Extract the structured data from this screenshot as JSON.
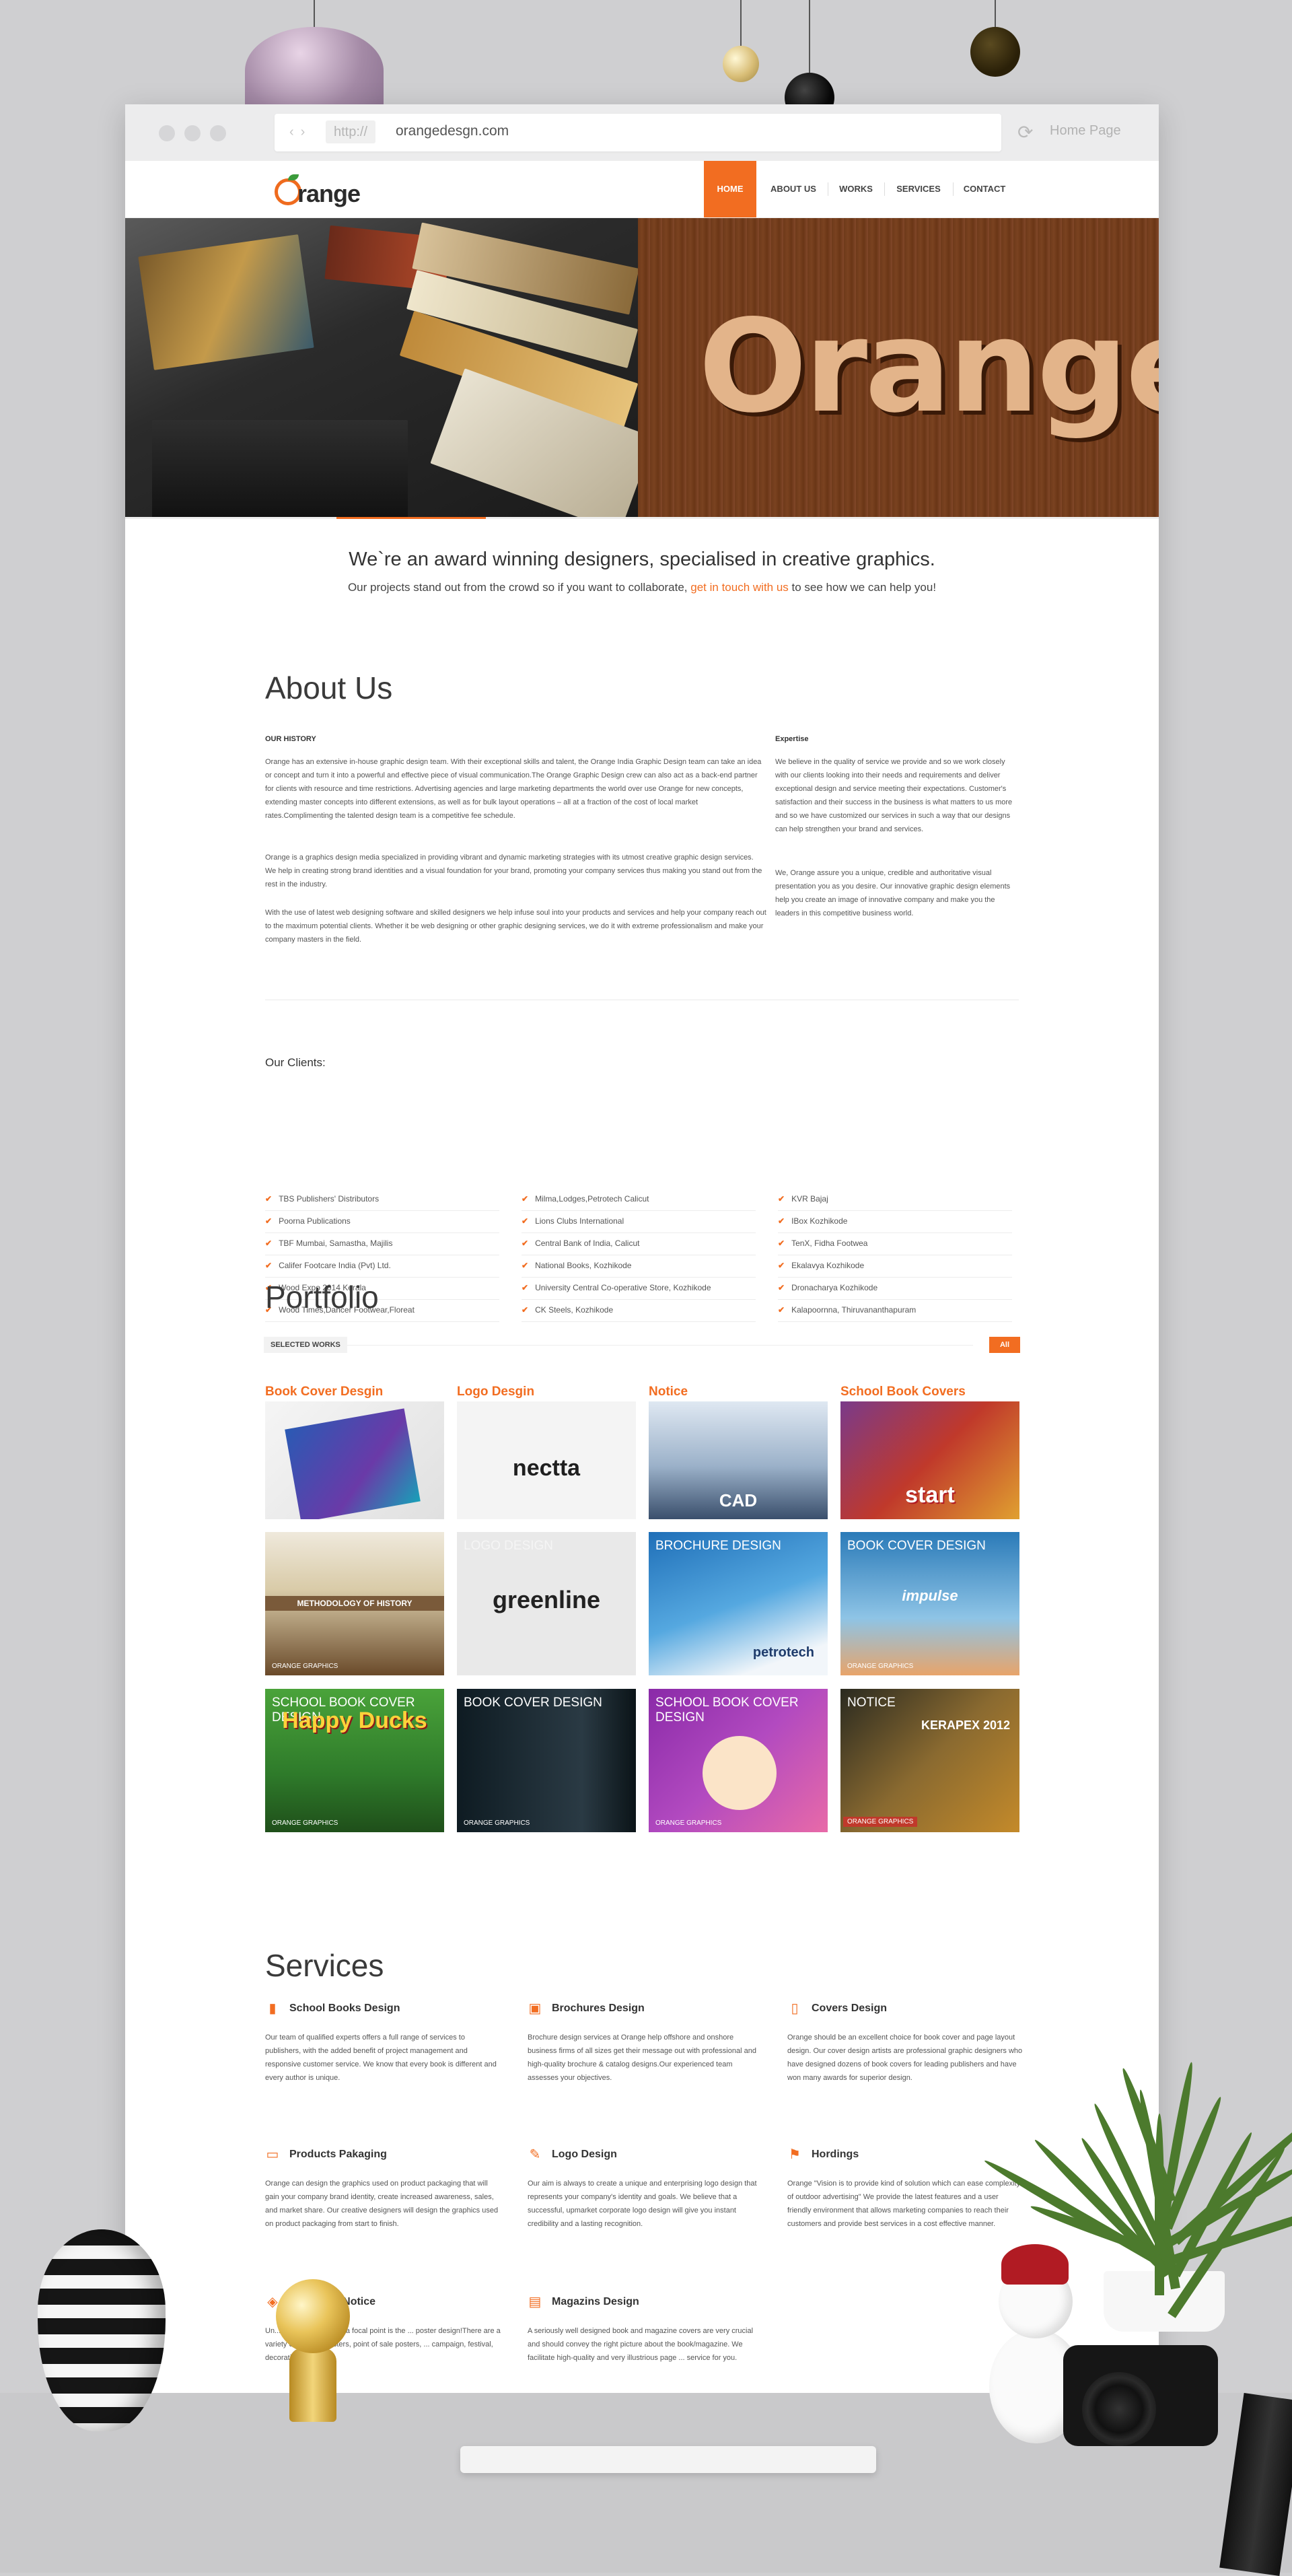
{
  "browser": {
    "protocol": "http://",
    "domain": "orangedesgn.com",
    "home_label": "Home Page"
  },
  "site": {
    "logo_word": "range",
    "nav": [
      "HOME",
      "ABOUT US",
      "WORKS",
      "SERVICES",
      "CONTACT"
    ],
    "hero_word": "Orange"
  },
  "intro": {
    "headline": "We`re an award winning designers, specialised in creative graphics.",
    "sub_before": "Our projects stand out from the crowd so if you want to collaborate, ",
    "sub_link": "get in touch with us",
    "sub_after": " to see how we can help you!"
  },
  "about": {
    "title": "About Us",
    "history_head": "OUR HISTORY",
    "history_p1": "Orange has an extensive in-house graphic design team. With their exceptional skills and talent, the Orange India Graphic Design team can take an idea or concept and turn it into a powerful and effective piece of visual communication.The Orange Graphic Design crew can also act as a back-end partner for clients with resource and time restrictions. Advertising agencies and large marketing departments the world over use Orange for new concepts, extending master concepts into different extensions, as well as for bulk layout operations – all at a fraction of the cost of local market rates.Complimenting the talented design team is a competitive fee schedule.",
    "history_p2": "Orange is a graphics design media specialized in providing vibrant and dynamic marketing strategies with its utmost creative graphic design services. We help in creating strong brand identities and a visual foundation for your brand, promoting your company services thus making you stand out from the rest in the industry.",
    "history_p3": "With the use of latest web designing software and skilled designers we help infuse soul into your products and services and help your company reach out to the maximum potential clients. Whether it be web designing or other graphic designing services, we do it with extreme professionalism and make your company masters in the field.",
    "expertise_head": "Expertise",
    "expertise_p1": "We believe in the quality of service we provide and so we work closely with our clients looking into their needs and requirements and deliver exceptional design and service meeting their expectations. Customer's satisfaction and their success in the business is what matters to us more and so we have customized our services in such a way that our designs can help strengthen your brand and services.",
    "expertise_p2": "We, Orange assure you a unique, credible and authoritative visual presentation you as you desire. Our innovative graphic design elements help you create an image of innovative company and make you the leaders in this competitive business world."
  },
  "clients": {
    "title": "Our Clients:",
    "col1": [
      "TBS Publishers' Distributors",
      "Poorna Publications",
      "TBF Mumbai, Samastha, Majilis",
      "Califer Footcare India (Pvt) Ltd.",
      "Wood Expo 2014 Kerala",
      "Wood Times,Dancer Footwear,Floreat"
    ],
    "col2": [
      "Milma,Lodges,Petrotech Calicut",
      "Lions Clubs International",
      "Central Bank of India, Calicut",
      "National Books, Kozhikode",
      "University Central Co-operative Store, Kozhikode",
      "CK Steels, Kozhikode"
    ],
    "col3": [
      "KVR Bajaj",
      "IBox Kozhikode",
      "TenX, Fidha Footwea",
      "Ekalavya Kozhikode",
      "Dronacharya Kozhikode",
      "Kalapoornna, Thiruvananthapuram"
    ]
  },
  "portfolio": {
    "title": "Portfolio",
    "selected_works": "SELECTED WORKS",
    "filter_all": "All",
    "columns": [
      "Book Cover Desgin",
      "Logo Desgin",
      "Notice",
      "School Book Covers"
    ],
    "thumb_texts": {
      "necta": "nectta",
      "greenline": "greenline",
      "logo_design": "LOGO DESIGN",
      "brochure": "BROCHURE DESIGN",
      "book_cover": "BOOK COVER DESIGN",
      "school_book": "SCHOOL BOOK COVER DESIGN",
      "notice": "NOTICE",
      "orange_graphics": "ORANGE GRAPHICS",
      "happy_ducks": "Happy Ducks",
      "kerapex": "KERAPEX 2012",
      "impulse": "impulse",
      "petrotech": "petrotech",
      "start": "start",
      "cad": "CAD",
      "methodology": "METHODOLOGY OF HISTORY"
    }
  },
  "services": {
    "title": "Services",
    "items": [
      {
        "icon": "book-icon",
        "title": "School Books Design",
        "text": "Our team of qualified experts offers a full range of services to publishers, with the added benefit of project management and responsive customer service. We know that every book is different and every author is unique."
      },
      {
        "icon": "image-icon",
        "title": "Brochures Design",
        "text": "Brochure design services at Orange help offshore and onshore business firms of all sizes get their message out with professional and high-quality brochure & catalog designs.Our experienced team assesses your objectives."
      },
      {
        "icon": "file-icon",
        "title": "Covers Design",
        "text": "Orange should be an excellent choice for book cover and page layout design. Our cover design artists are professional graphic designers who have designed dozens of book covers for leading publishers and have won many awards for superior design."
      },
      {
        "icon": "folder-icon",
        "title": "Products Pakaging",
        "text": "Orange can design the graphics used on product packaging that will gain your company brand identity, create increased awareness, sales, and market share. Our creative designers will design the graphics used on product packaging from start to finish."
      },
      {
        "icon": "magic-wand-icon",
        "title": "Logo Design",
        "text": "Our aim is always to create a unique and enterprising logo design that represents your company's identity and goals. We believe that a successful, upmarket corporate logo design will give you instant credibility and a lasting recognition."
      },
      {
        "icon": "bookmark-icon",
        "title": "Hordings",
        "text": "Orange \"Vision is to provide kind of solution which can ease complexity of outdoor advertising\" We provide the latest features and a user friendly environment that allows marketing companies to reach their customers and provide best services in a cost effective manner."
      },
      {
        "icon": "tag-icon",
        "title": "Posters & Notice",
        "text": "Un... advertising around a focal point is the ... poster design!There are a variety of ... show posters, point of sale posters, ... campaign, festival, decorative ..."
      },
      {
        "icon": "newspaper-icon",
        "title": "Magazins Design",
        "text": "A seriously well designed book and magazine covers are very crucial and should convey the right picture about the book/magazine. We facilitate high-quality and very illustrious page ... service for you."
      }
    ]
  },
  "colors": {
    "accent": "#f26d21",
    "text": "#444444",
    "background": "#cfcfd1"
  }
}
